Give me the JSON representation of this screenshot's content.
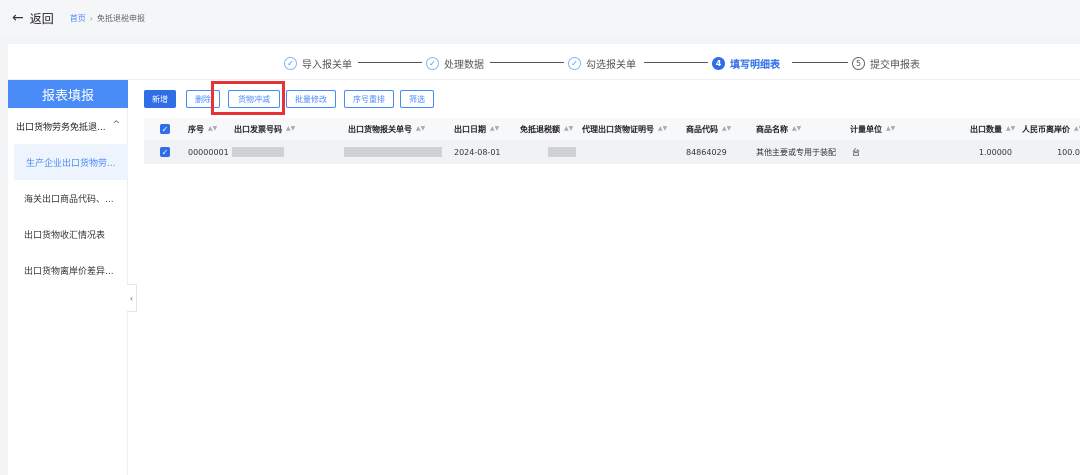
{
  "topbar": {
    "back_label": "返回",
    "breadcrumb": {
      "home": "首页",
      "current": "免抵退税申报"
    }
  },
  "steps": [
    {
      "marker": "✓",
      "label": "导入报关单",
      "state": "done"
    },
    {
      "marker": "✓",
      "label": "处理数据",
      "state": "done"
    },
    {
      "marker": "✓",
      "label": "勾选报关单",
      "state": "done"
    },
    {
      "marker": "4",
      "label": "填写明细表",
      "state": "active"
    },
    {
      "marker": "5",
      "label": "提交申报表",
      "state": "pending"
    }
  ],
  "sidebar": {
    "title": "报表填报",
    "group_label": "出口货物劳务免抵退...",
    "items": [
      {
        "label": "生产企业出口货物劳...",
        "active": true
      },
      {
        "label": "海关出口商品代码、...",
        "active": false
      },
      {
        "label": "出口货物收汇情况表",
        "active": false
      },
      {
        "label": "出口货物离岸价差异...",
        "active": false
      }
    ]
  },
  "toolbar": {
    "add": "新增",
    "delete": "删除",
    "offset": "货物冲减",
    "batch_edit": "批量修改",
    "reorder": "序号重排",
    "filter": "筛选"
  },
  "table": {
    "columns": [
      "序号",
      "出口发票号码",
      "出口货物报关单号",
      "出口日期",
      "免抵退税额",
      "代理出口货物证明号",
      "商品代码",
      "商品名称",
      "计量单位",
      "出口数量",
      "人民币离岸价"
    ],
    "rows": [
      {
        "seq": "00000001",
        "invoice_no": "",
        "customs_no": "",
        "export_date": "2024-08-01",
        "refund_amount": "",
        "agent_cert": "",
        "product_code": "84864029",
        "product_name": "其他主要或专用于装配",
        "unit": "台",
        "quantity": "1.00000",
        "fob_rmb": "100.0"
      }
    ]
  },
  "colors": {
    "primary": "#2f6ee6",
    "sidebar_header": "#4a8cf7",
    "highlight": "#e8323a"
  }
}
